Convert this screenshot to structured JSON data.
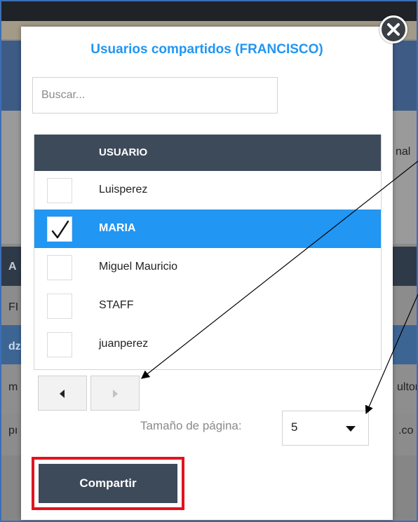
{
  "background": {
    "side_text_1": "nal",
    "side_text_2": "ultor",
    "side_text_3": ".co",
    "left_text_fi": "FI",
    "left_text_az": "A",
    "left_text_d": "dz",
    "left_text_m": "m",
    "left_text_p": "pı"
  },
  "modal": {
    "title": "Usuarios compartidos (FRANCISCO)",
    "search": {
      "placeholder": "Buscar...",
      "value": ""
    },
    "grid": {
      "column_header": "USUARIO",
      "rows": [
        {
          "label": "Luisperez",
          "checked": false,
          "selected": false
        },
        {
          "label": "MARIA",
          "checked": true,
          "selected": true
        },
        {
          "label": "Miguel Mauricio",
          "checked": false,
          "selected": false
        },
        {
          "label": "STAFF",
          "checked": false,
          "selected": false
        },
        {
          "label": "juanperez",
          "checked": false,
          "selected": false
        }
      ]
    },
    "pager": {
      "prev_icon": "triangle-left-icon",
      "next_icon": "triangle-right-icon",
      "page_size_label": "Tamaño de página:",
      "page_size_value": "5"
    },
    "share_button_label": "Compartir",
    "close_icon": "close-icon"
  },
  "colors": {
    "accent": "#2196f3",
    "header_bg": "#3d4a5a",
    "highlight_border": "#e0141f"
  }
}
